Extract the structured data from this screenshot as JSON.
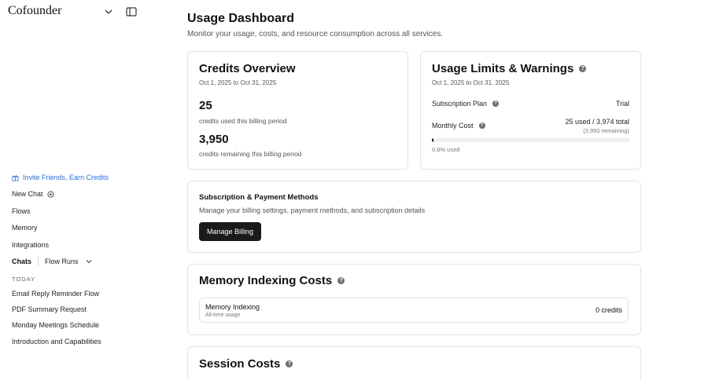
{
  "sidebar": {
    "brand": "Cofounder",
    "invite": "Invite Friends, Earn Credits",
    "new_chat": "New Chat",
    "flows": "Flows",
    "memory": "Memory",
    "integrations": "Integrations",
    "tabs": {
      "chats": "Chats",
      "flow_runs": "Flow Runs"
    },
    "section_today": "TODAY",
    "recent": [
      "Email Reply Reminder Flow",
      "PDF Summary Request",
      "Monday Meetings Schedule",
      "Introduction and Capabilities"
    ]
  },
  "page": {
    "title": "Usage Dashboard",
    "subtitle": "Monitor your usage, costs, and resource consumption across all services."
  },
  "credits": {
    "title": "Credits Overview",
    "range": "Oct 1, 2025 to Oct 31, 2025",
    "used_value": "25",
    "used_label": "credits used this billing period",
    "remaining_value": "3,950",
    "remaining_label": "credits remaining this billing period"
  },
  "limits": {
    "title": "Usage Limits & Warnings",
    "range": "Oct 1, 2025 to Oct 31, 2025",
    "plan_label": "Subscription Plan",
    "plan_value": "Trial",
    "monthly_label": "Monthly Cost",
    "monthly_value": "25 used / 3,974 total",
    "monthly_remaining": "(3,950 remaining)",
    "percent_text": "0.6% used",
    "percent_used": 0.6
  },
  "billing": {
    "title": "Subscription & Payment Methods",
    "desc": "Manage your billing settings, payment methods, and subscription details",
    "button": "Manage Billing"
  },
  "memory_costs": {
    "title": "Memory Indexing Costs",
    "item_title": "Memory Indexing",
    "item_sub": "All-time usage",
    "item_value": "0 credits"
  },
  "session_costs": {
    "title": "Session Costs"
  },
  "icons": {
    "help": "?"
  }
}
